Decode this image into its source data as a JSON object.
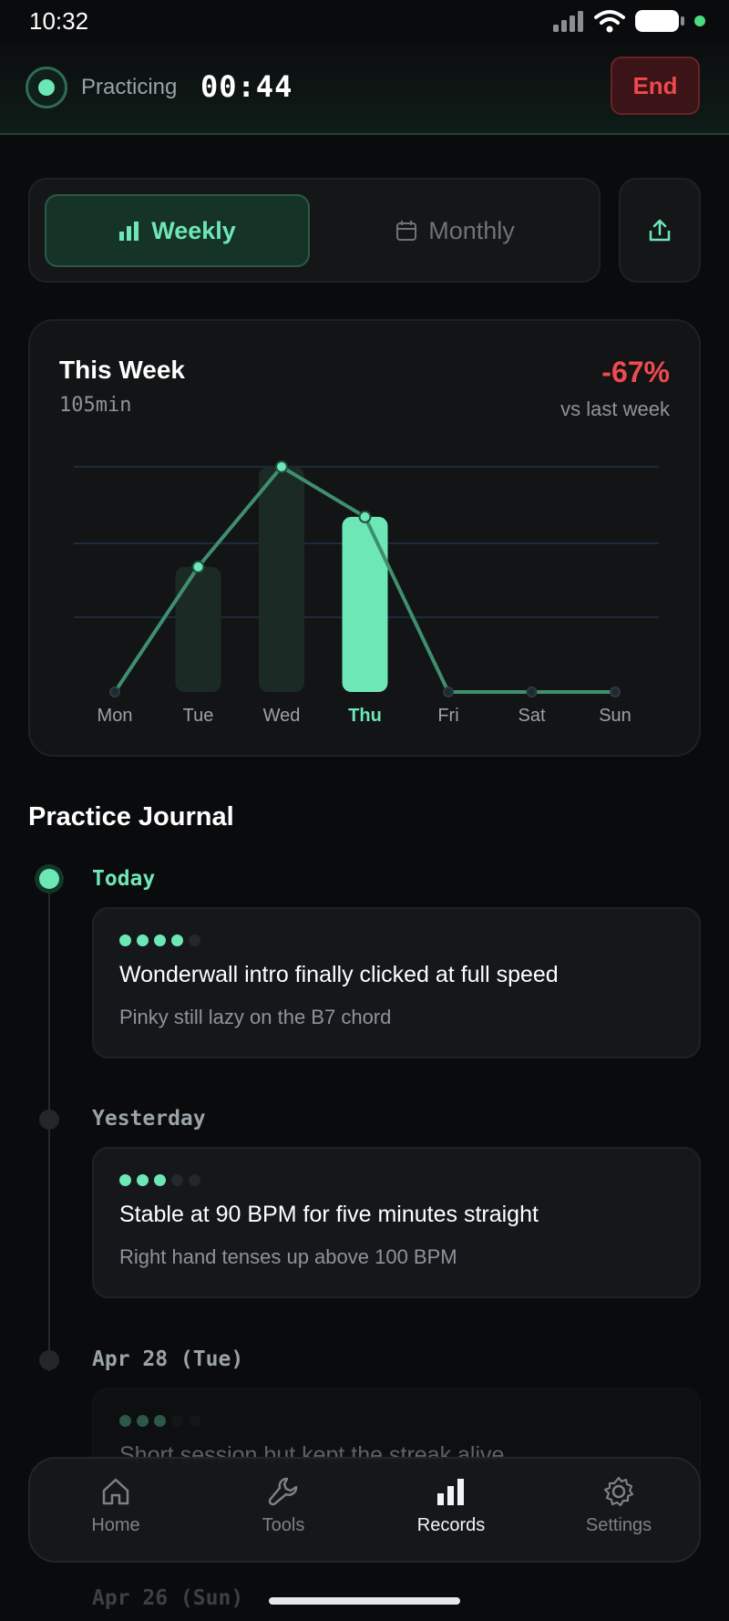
{
  "status_bar": {
    "time": "10:32"
  },
  "session": {
    "label": "Practicing",
    "timer": "00:44",
    "end_label": "End"
  },
  "tabs": [
    {
      "label": "Weekly",
      "icon": "bar-chart-icon",
      "active": true
    },
    {
      "label": "Monthly",
      "icon": "calendar-icon",
      "active": false
    }
  ],
  "share_icon": "share-icon",
  "summary": {
    "title": "This Week",
    "total": "105min",
    "change": "-67%",
    "compare": "vs last week"
  },
  "colors": {
    "accent": "#6ee7b7",
    "negative": "#ef4a4f",
    "background": "#0a0b0d"
  },
  "chart_data": {
    "type": "bar",
    "categories": [
      "Mon",
      "Tue",
      "Wed",
      "Thu",
      "Fri",
      "Sat",
      "Sun"
    ],
    "values": [
      0,
      25,
      45,
      35,
      0,
      0,
      0
    ],
    "highlight": "Thu",
    "ylim": [
      0,
      45
    ],
    "grid": true
  },
  "journal": {
    "title": "Practice Journal",
    "entries": [
      {
        "date": "Today",
        "rating": 4,
        "text": "Wonderwall intro finally clicked at full speed",
        "note": "Pinky still lazy on the B7 chord"
      },
      {
        "date": "Yesterday",
        "rating": 3,
        "text": "Stable at 90 BPM for five minutes straight",
        "note": "Right hand tenses up above 100 BPM"
      },
      {
        "date": "Apr 28 (Tue)",
        "rating": 3,
        "text": "Short session but kept the streak alive",
        "note": ""
      },
      {
        "date": "Apr 26 (Sun)"
      }
    ]
  },
  "nav": [
    {
      "label": "Home",
      "icon": "home-icon"
    },
    {
      "label": "Tools",
      "icon": "wrench-icon"
    },
    {
      "label": "Records",
      "icon": "bar-chart-icon",
      "active": true
    },
    {
      "label": "Settings",
      "icon": "gear-icon"
    }
  ]
}
